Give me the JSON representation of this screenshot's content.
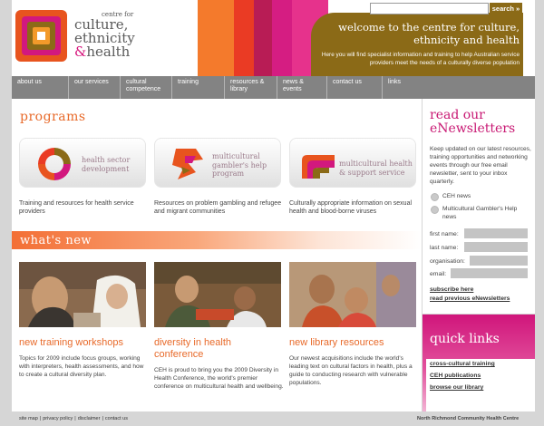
{
  "header": {
    "logo": {
      "line1": "centre for",
      "line2": "culture,",
      "line3": "ethnicity",
      "line4_amp": "&",
      "line4": "health"
    },
    "search": {
      "value": "",
      "button_label": "search »"
    },
    "banner_title": "welcome to the centre for culture, ethnicity and health",
    "banner_desc": "Here you will find specialist information and training to help Australian service providers meet the needs of a culturally diverse population"
  },
  "nav": [
    {
      "label": "about us"
    },
    {
      "label": "our services"
    },
    {
      "label": "cultural competence"
    },
    {
      "label": "training"
    },
    {
      "label": "resources & library"
    },
    {
      "label": "news & events"
    },
    {
      "label": "contact us"
    },
    {
      "label": "links"
    }
  ],
  "programs": {
    "title": "programs",
    "items": [
      {
        "title": "health sector development",
        "desc": "Training and resources for health service providers"
      },
      {
        "title": "multicultural gambler's help program",
        "desc": "Resources on problem gambling and refugee and migrant communities"
      },
      {
        "title": "multicultural health & support service",
        "desc": "Culturally appropriate information on sexual health and blood-borne viruses"
      }
    ]
  },
  "whats_new": {
    "title": "what's new",
    "items": [
      {
        "title": "new training workshops",
        "desc": "Topics for 2009 include focus groups, working with interpreters, health assessments, and how to create a cultural diversity plan."
      },
      {
        "title": "diversity in health conference",
        "desc": "CEH is proud to bring you the 2009 Diversity in Health Conference, the world's premier conference on multicultural health and wellbeing."
      },
      {
        "title": "new library resources",
        "desc": "Our newest acquisitions include the world's leading text on cultural factors in health, plus a guide to conducting research with vulnerable populations."
      }
    ]
  },
  "enewsletters": {
    "title": "read our eNewsletters",
    "desc": "Keep updated on our latest resources, training opportunities and networking events through our free email newsletter, sent to your inbox quarterly.",
    "options": [
      "CEH news",
      "Multicultural Gambler's Help news"
    ],
    "fields": [
      {
        "label": "first name:",
        "value": ""
      },
      {
        "label": "last name:",
        "value": ""
      },
      {
        "label": "organisation:",
        "value": ""
      },
      {
        "label": "email:",
        "value": ""
      }
    ],
    "subscribe_label": "subscribe here",
    "previous_label": "read previous eNewsletters"
  },
  "quick_links": {
    "title": "quick links",
    "items": [
      "cross-cultural training",
      "CEH publications",
      "browse our library"
    ]
  },
  "footer": {
    "links": [
      "site map",
      "privacy policy",
      "disclaimer",
      "contact us"
    ],
    "separator": "|",
    "org": "North Richmond Community Health Centre"
  },
  "colors": {
    "accent_orange": "#e86a2a",
    "accent_magenta": "#c81873",
    "banner_brown": "#8b6a17",
    "nav_grey": "#838383"
  }
}
